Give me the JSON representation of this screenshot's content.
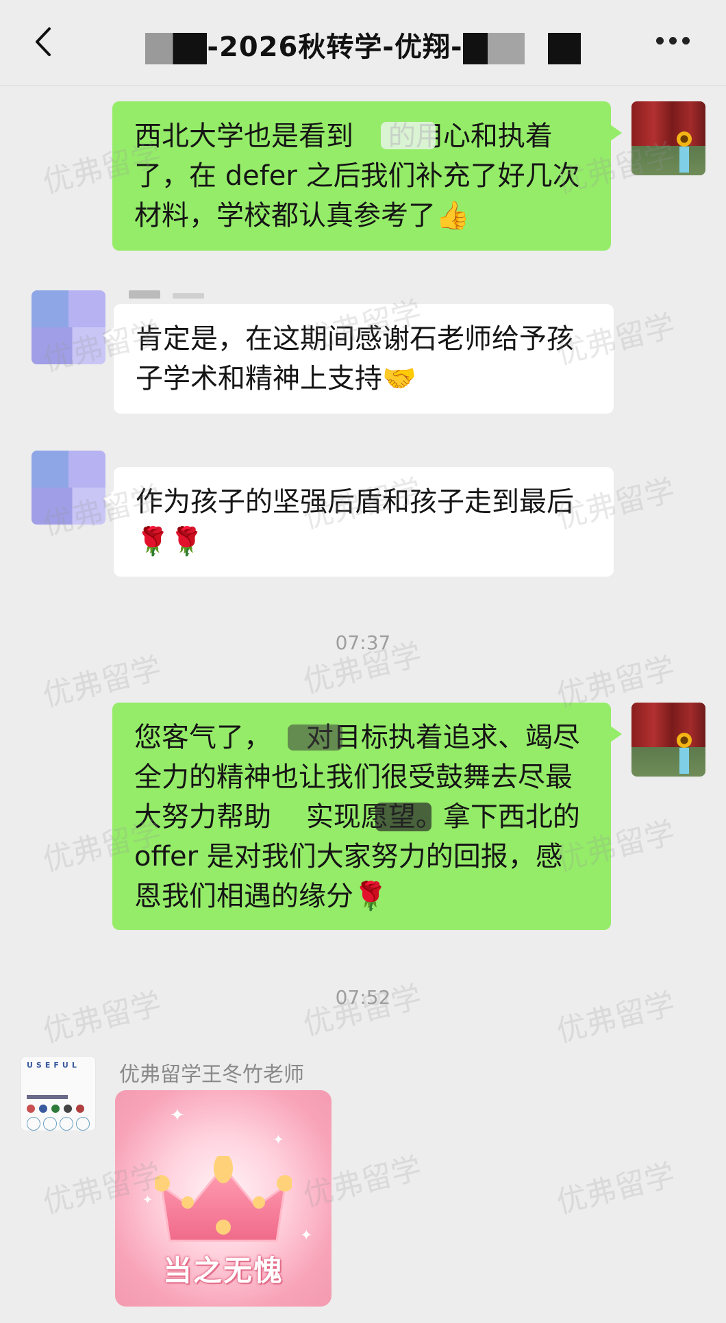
{
  "header": {
    "title": "-2026秋转学-优翔-",
    "back_icon": "chevron-left-icon",
    "more_icon": "more-icon"
  },
  "messages": [
    {
      "side": "me",
      "text": "西北大学也是看到    的用心和执着了，在 defer 之后我们补充了好几次材料，学校都认真参考了👍"
    },
    {
      "side": "other",
      "text": "肯定是，在这期间感谢石老师给予孩子学术和精神上支持🤝"
    },
    {
      "side": "other",
      "text": "作为孩子的坚强后盾和孩子走到最后🌹🌹"
    },
    {
      "side": "me",
      "text": "您客气了，    对目标执着追求、竭尽全力的精神也让我们很受鼓舞去尽最大努力帮助    实现愿望。拿下西北的 offer 是对我们大家努力的回报，感恩我们相遇的缘分🌹"
    }
  ],
  "timestamps": [
    "07:37",
    "07:52"
  ],
  "teacher": {
    "nickname": "优弗留学王冬竹老师",
    "avatar_logo": "USEFUL"
  },
  "sticker": {
    "text": "当之无愧"
  },
  "watermark": "优弗留学"
}
